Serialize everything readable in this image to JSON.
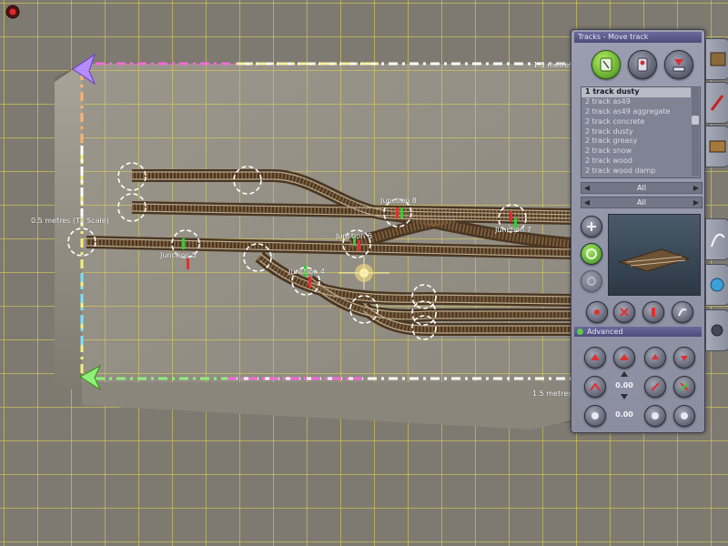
{
  "viewport": {
    "labels": {
      "dimension_top": "1.5 metres",
      "dimension_left": "0.5 metres (TT Scale)",
      "dimension_bottom": "1.5 metres",
      "junction_8": "Junction 8",
      "junction_7": "Junction 7",
      "junction_6": "Junction 6",
      "junction_5": "Junction 5",
      "junction_4": "Junction 4"
    }
  },
  "panel": {
    "title": "Tracks - Move track",
    "tools": [
      {
        "icon": "track-lay-icon",
        "active": true
      },
      {
        "icon": "track-alt-icon",
        "active": false
      },
      {
        "icon": "height-marker-icon",
        "active": false
      }
    ],
    "track_list": [
      "1 track dusty",
      "2 track as49",
      "2 track as49 aggregate",
      "2 track concrete",
      "2 track dusty",
      "2 track greasy",
      "2 track snow",
      "2 track wood",
      "2 track wood damp"
    ],
    "selected_track": "1 track dusty",
    "filters": [
      "All",
      "All"
    ],
    "advanced_label": "Advanced",
    "values": {
      "value_1": "0.00",
      "value_2": "0.00"
    },
    "colors": {
      "panel_bg": "#8e92a4",
      "title_bar": "#4c4d7a",
      "active_tool": "#5fb81f"
    }
  },
  "side_tabs": [
    {
      "icon": "track-piece-icon"
    },
    {
      "icon": "paint-brush-icon"
    },
    {
      "icon": "train-car-icon"
    },
    {
      "icon": "spline-icon"
    },
    {
      "icon": "globe-icon"
    },
    {
      "icon": "settings-icon"
    }
  ]
}
